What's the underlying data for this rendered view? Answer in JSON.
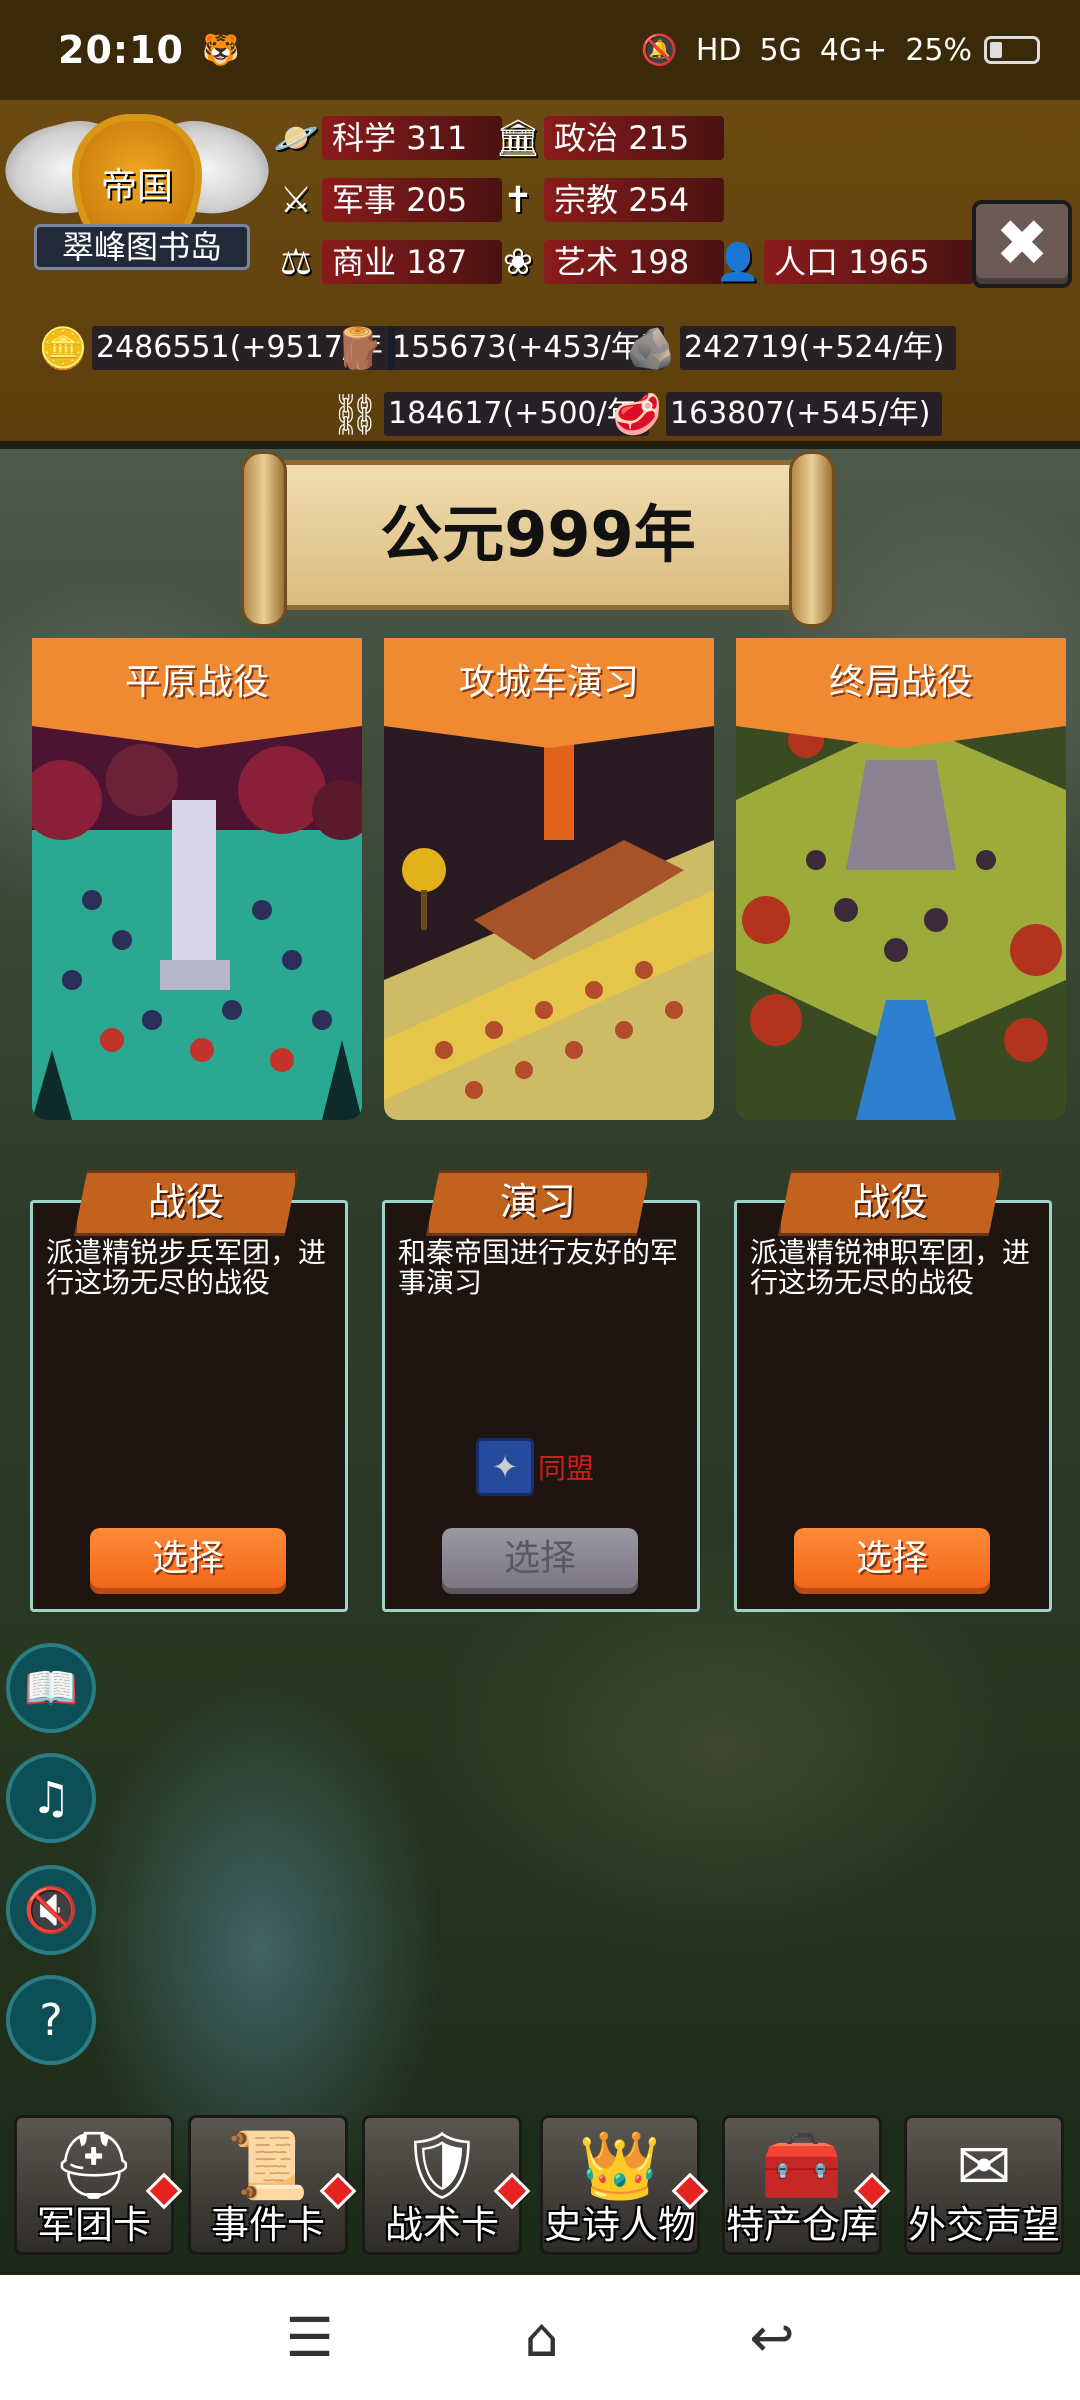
{
  "status_bar": {
    "time": "20:10",
    "network": "5G",
    "network2": "4G+",
    "battery": "25%"
  },
  "player": {
    "empire_label": "帝国",
    "name": "翠峰图书岛"
  },
  "stats": {
    "science": {
      "label": "科学",
      "value": "311"
    },
    "politics": {
      "label": "政治",
      "value": "215"
    },
    "military": {
      "label": "军事",
      "value": "205"
    },
    "religion": {
      "label": "宗教",
      "value": "254"
    },
    "commerce": {
      "label": "商业",
      "value": "187"
    },
    "art": {
      "label": "艺术",
      "value": "198"
    },
    "population": {
      "label": "人口",
      "value": "1965"
    }
  },
  "resources": {
    "gold": "2486551(+9517/年",
    "wood": "155673(+453/年)",
    "stone": "242719(+524/年)",
    "iron": "184617(+500/年",
    "meat": "163807(+545/年)"
  },
  "year_banner": "公元999年",
  "cards": [
    {
      "title": "平原战役",
      "tag": "战役",
      "desc": "派遣精锐步兵军团，进行这场无尽的战役",
      "button": "选择",
      "enabled": true
    },
    {
      "title": "攻城车演习",
      "tag": "演习",
      "desc": "和秦帝国进行友好的军事演习",
      "ally": "同盟",
      "button": "选择",
      "enabled": false
    },
    {
      "title": "终局战役",
      "tag": "战役",
      "desc": "派遣精锐神职军团，进行这场无尽的战役",
      "button": "选择",
      "enabled": true
    }
  ],
  "bottom_menu": [
    {
      "label": "军团卡",
      "icon": "helmet-icon"
    },
    {
      "label": "事件卡",
      "icon": "scroll-icon"
    },
    {
      "label": "战术卡",
      "icon": "shield-icon"
    },
    {
      "label": "史诗人物",
      "icon": "crown-icon"
    },
    {
      "label": "特产仓库",
      "icon": "chest-icon"
    },
    {
      "label": "外交声望",
      "icon": "letter-icon"
    }
  ],
  "colors": {
    "header_bg": "#5c3f0c",
    "card_title": "#f08a32",
    "button_orange": "#f06416",
    "panel_border": "#9fd3c9"
  }
}
